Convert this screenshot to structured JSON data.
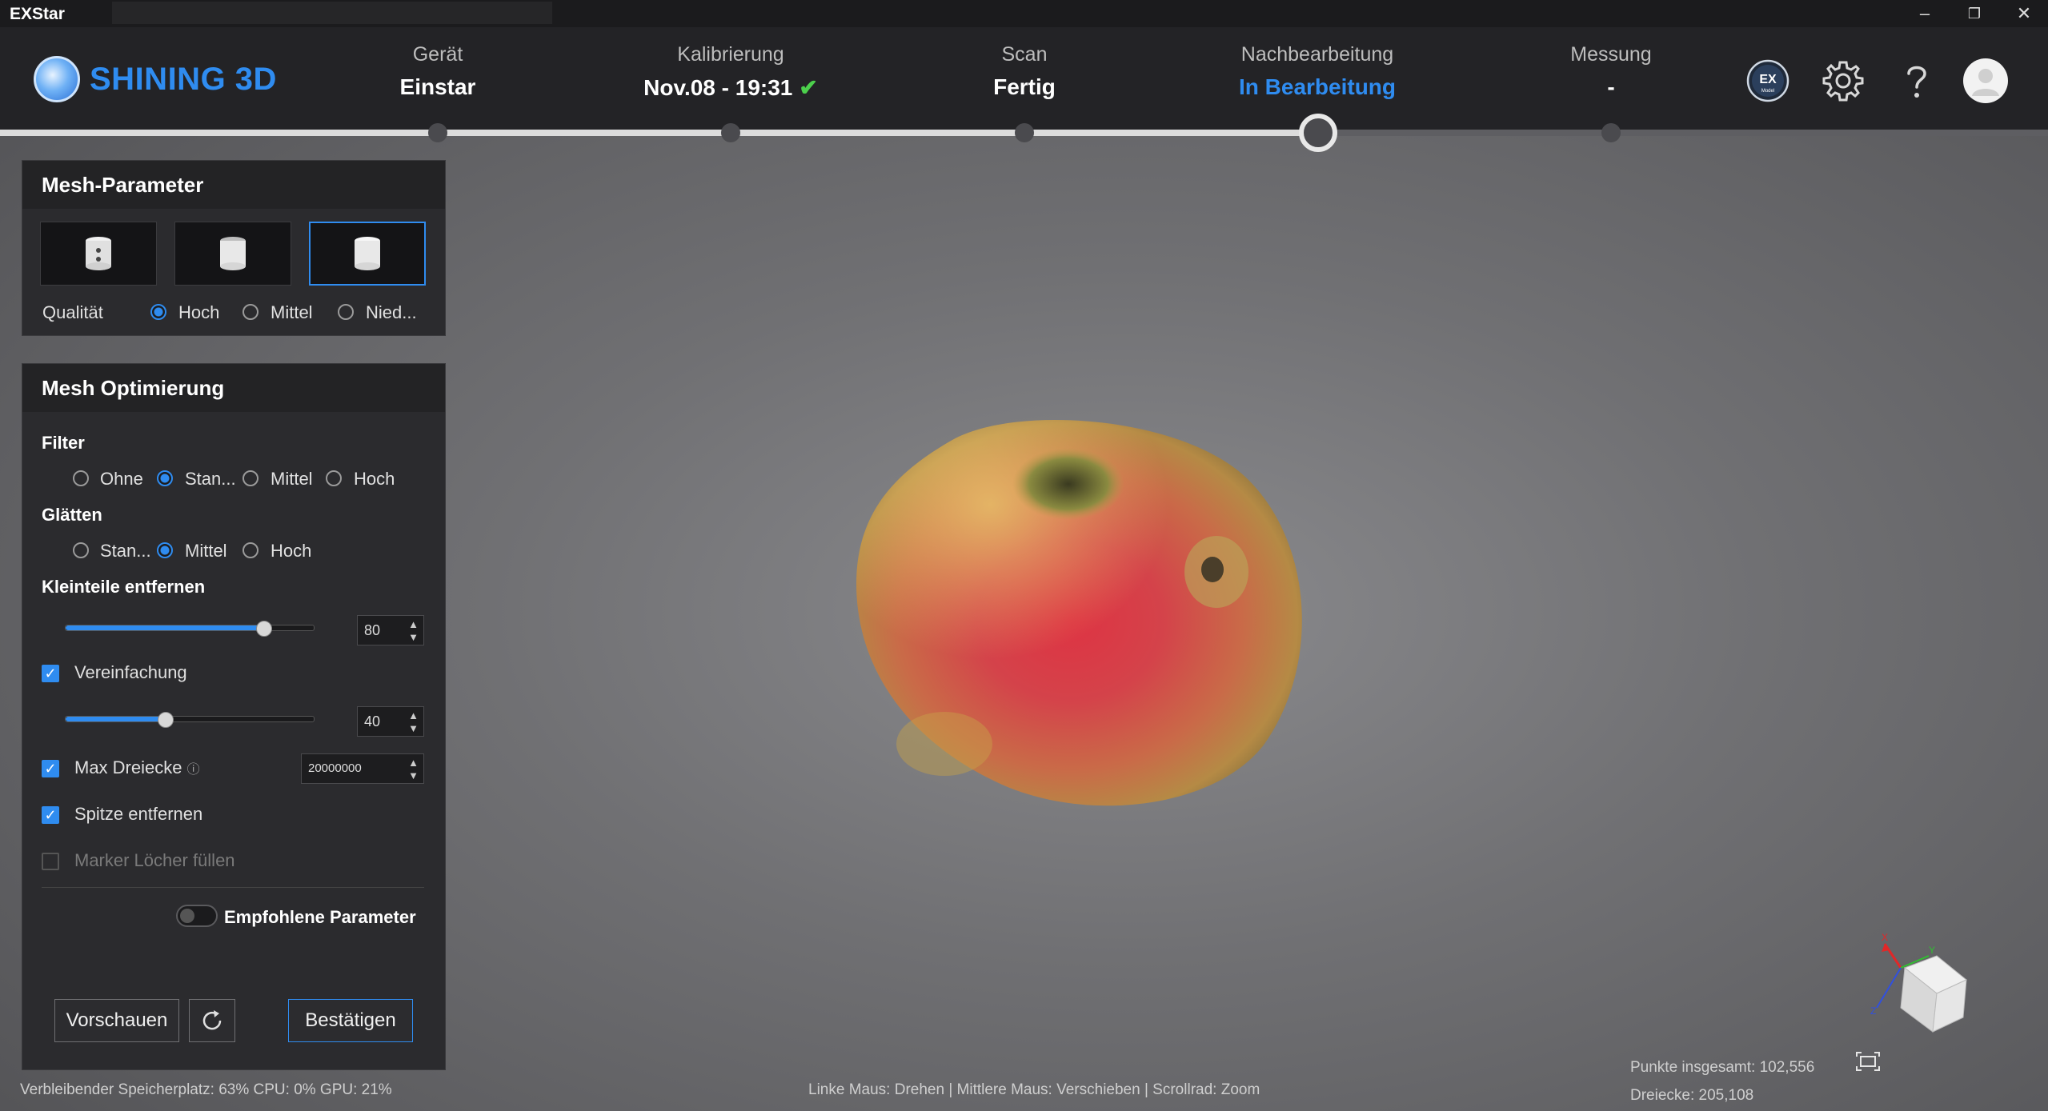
{
  "app": {
    "title": "EXStar"
  },
  "window_controls": {
    "minimize": "–",
    "restore": "❐",
    "close": "✕"
  },
  "header": {
    "brand": "SHINING 3D",
    "steps": [
      {
        "label": "Gerät",
        "value": "Einstar"
      },
      {
        "label": "Kalibrierung",
        "value": "Nov.08 - 19:31",
        "check": "✔"
      },
      {
        "label": "Scan",
        "value": "Fertig"
      },
      {
        "label": "Nachbearbeitung",
        "value": "In Bearbeitung"
      },
      {
        "label": "Messung",
        "value": "-"
      }
    ],
    "icons": [
      "ex-model-icon",
      "gear-icon",
      "help-icon",
      "avatar"
    ],
    "ex_icon_text": "EX",
    "ex_icon_sub": "Model",
    "accent_color": "#2f8cf0"
  },
  "mesh_params": {
    "title": "Mesh-Parameter",
    "quality_label": "Qualität",
    "quality_options": [
      "Hoch",
      "Mittel",
      "Nied..."
    ],
    "quality_selected": "Hoch"
  },
  "mesh_opt": {
    "title": "Mesh Optimierung",
    "filter_label": "Filter",
    "filter_options": [
      "Ohne",
      "Stan...",
      "Mittel",
      "Hoch"
    ],
    "filter_selected": "Stan...",
    "smooth_label": "Glätten",
    "smooth_options": [
      "Stan...",
      "Mittel",
      "Hoch"
    ],
    "smooth_selected": "Mittel",
    "remove_small_label": "Kleinteile entfernen",
    "remove_small_value": "80",
    "simplify_label": "Vereinfachung",
    "simplify_checked": true,
    "simplify_value": "40",
    "max_tri_label": "Max Dreiecke",
    "max_tri_info": "ⓘ",
    "max_tri_value": "20000000",
    "max_tri_checked": true,
    "spike_label": "Spitze entfernen",
    "spike_checked": true,
    "marker_label": "Marker Löcher füllen",
    "marker_checked": false,
    "recommended_label": "Empfohlene Parameter",
    "preview_label": "Vorschauen",
    "confirm_label": "Bestätigen"
  },
  "status": {
    "left": "Verbleibender Speicherplatz: 63%  CPU: 0%  GPU: 21%",
    "center": "Linke Maus: Drehen | Mittlere Maus: Verschieben | Scrollrad: Zoom",
    "points": "Punkte insgesamt: 102,556",
    "triangles": "Dreiecke: 205,108"
  },
  "axes": {
    "x": "X",
    "y": "Y",
    "z": "Z"
  }
}
